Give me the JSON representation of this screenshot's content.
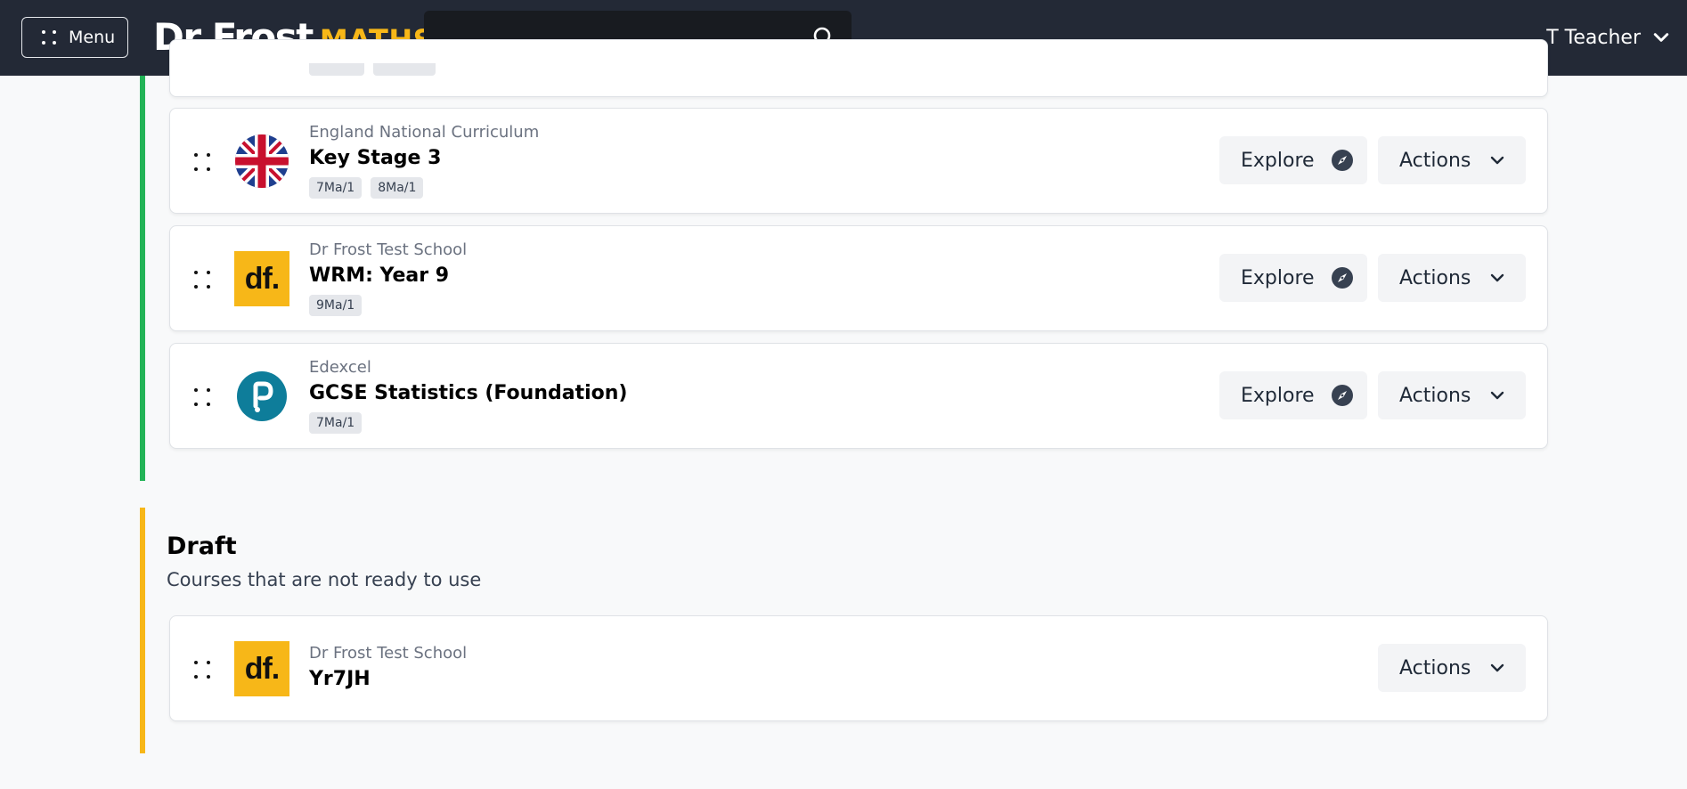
{
  "header": {
    "menu_label": "Menu",
    "logo_main": "Dr Frost",
    "logo_sub": "MATHS",
    "search_placeholder": "",
    "user_name": "T Teacher"
  },
  "live_section": {
    "courses": [
      {
        "provider": "England National Curriculum",
        "title": "Key Stage 3",
        "tags": [
          "7Ma/1",
          "8Ma/1"
        ],
        "icon": "uk-flag-icon",
        "explore_label": "Explore",
        "actions_label": "Actions"
      },
      {
        "provider": "Dr Frost Test School",
        "title": "WRM: Year 9",
        "tags": [
          "9Ma/1"
        ],
        "icon": "df-logo-icon",
        "logo_text": "df.",
        "explore_label": "Explore",
        "actions_label": "Actions"
      },
      {
        "provider": "Edexcel",
        "title": "GCSE Statistics (Foundation)",
        "tags": [
          "7Ma/1"
        ],
        "icon": "pearson-logo-icon",
        "explore_label": "Explore",
        "actions_label": "Actions"
      }
    ]
  },
  "draft_section": {
    "heading": "Draft",
    "subheading": "Courses that are not ready to use",
    "courses": [
      {
        "provider": "Dr Frost Test School",
        "title": "Yr7JH",
        "icon": "df-logo-icon",
        "logo_text": "df.",
        "actions_label": "Actions"
      }
    ]
  },
  "colors": {
    "header_bg": "#232936",
    "brand_yellow": "#f7b718",
    "live_green": "#22b356",
    "draft_yellow": "#f7b718"
  }
}
